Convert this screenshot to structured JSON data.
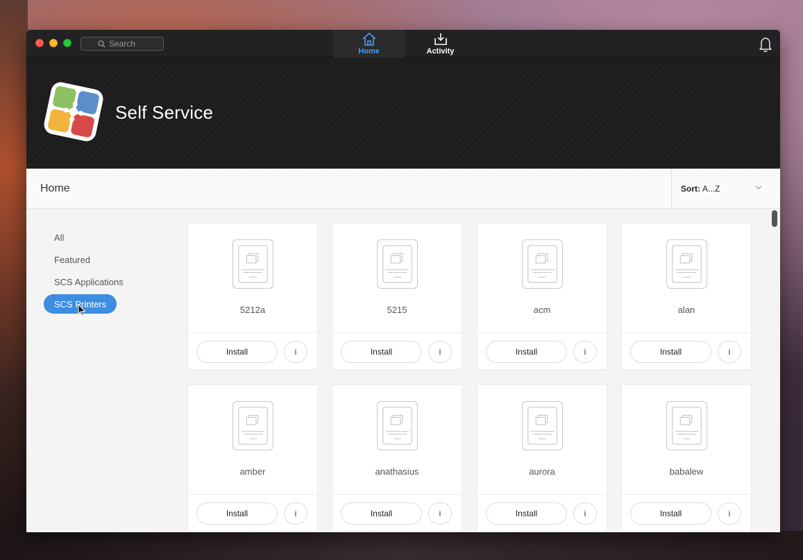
{
  "titlebar": {
    "search_placeholder": "Search",
    "tabs": [
      {
        "label": "Home",
        "icon": "home-icon",
        "active": true
      },
      {
        "label": "Activity",
        "icon": "download-icon",
        "active": false
      }
    ],
    "accent_color": "#4a9ce8"
  },
  "banner": {
    "title": "Self Service"
  },
  "header": {
    "title": "Home",
    "sort_label": "Sort:",
    "sort_value": "A...Z"
  },
  "sidebar": {
    "items": [
      {
        "label": "All",
        "active": false
      },
      {
        "label": "Featured",
        "active": false
      },
      {
        "label": "SCS Applications",
        "active": false
      },
      {
        "label": "SCS Printers",
        "active": true
      }
    ],
    "active_color": "#3d8de0"
  },
  "catalog": {
    "install_label": "Install",
    "info_label": "i",
    "items": [
      {
        "name": "5212a"
      },
      {
        "name": "5215"
      },
      {
        "name": "acm"
      },
      {
        "name": "alan"
      },
      {
        "name": "amber"
      },
      {
        "name": "anathasius"
      },
      {
        "name": "aurora"
      },
      {
        "name": "babalew"
      }
    ]
  }
}
